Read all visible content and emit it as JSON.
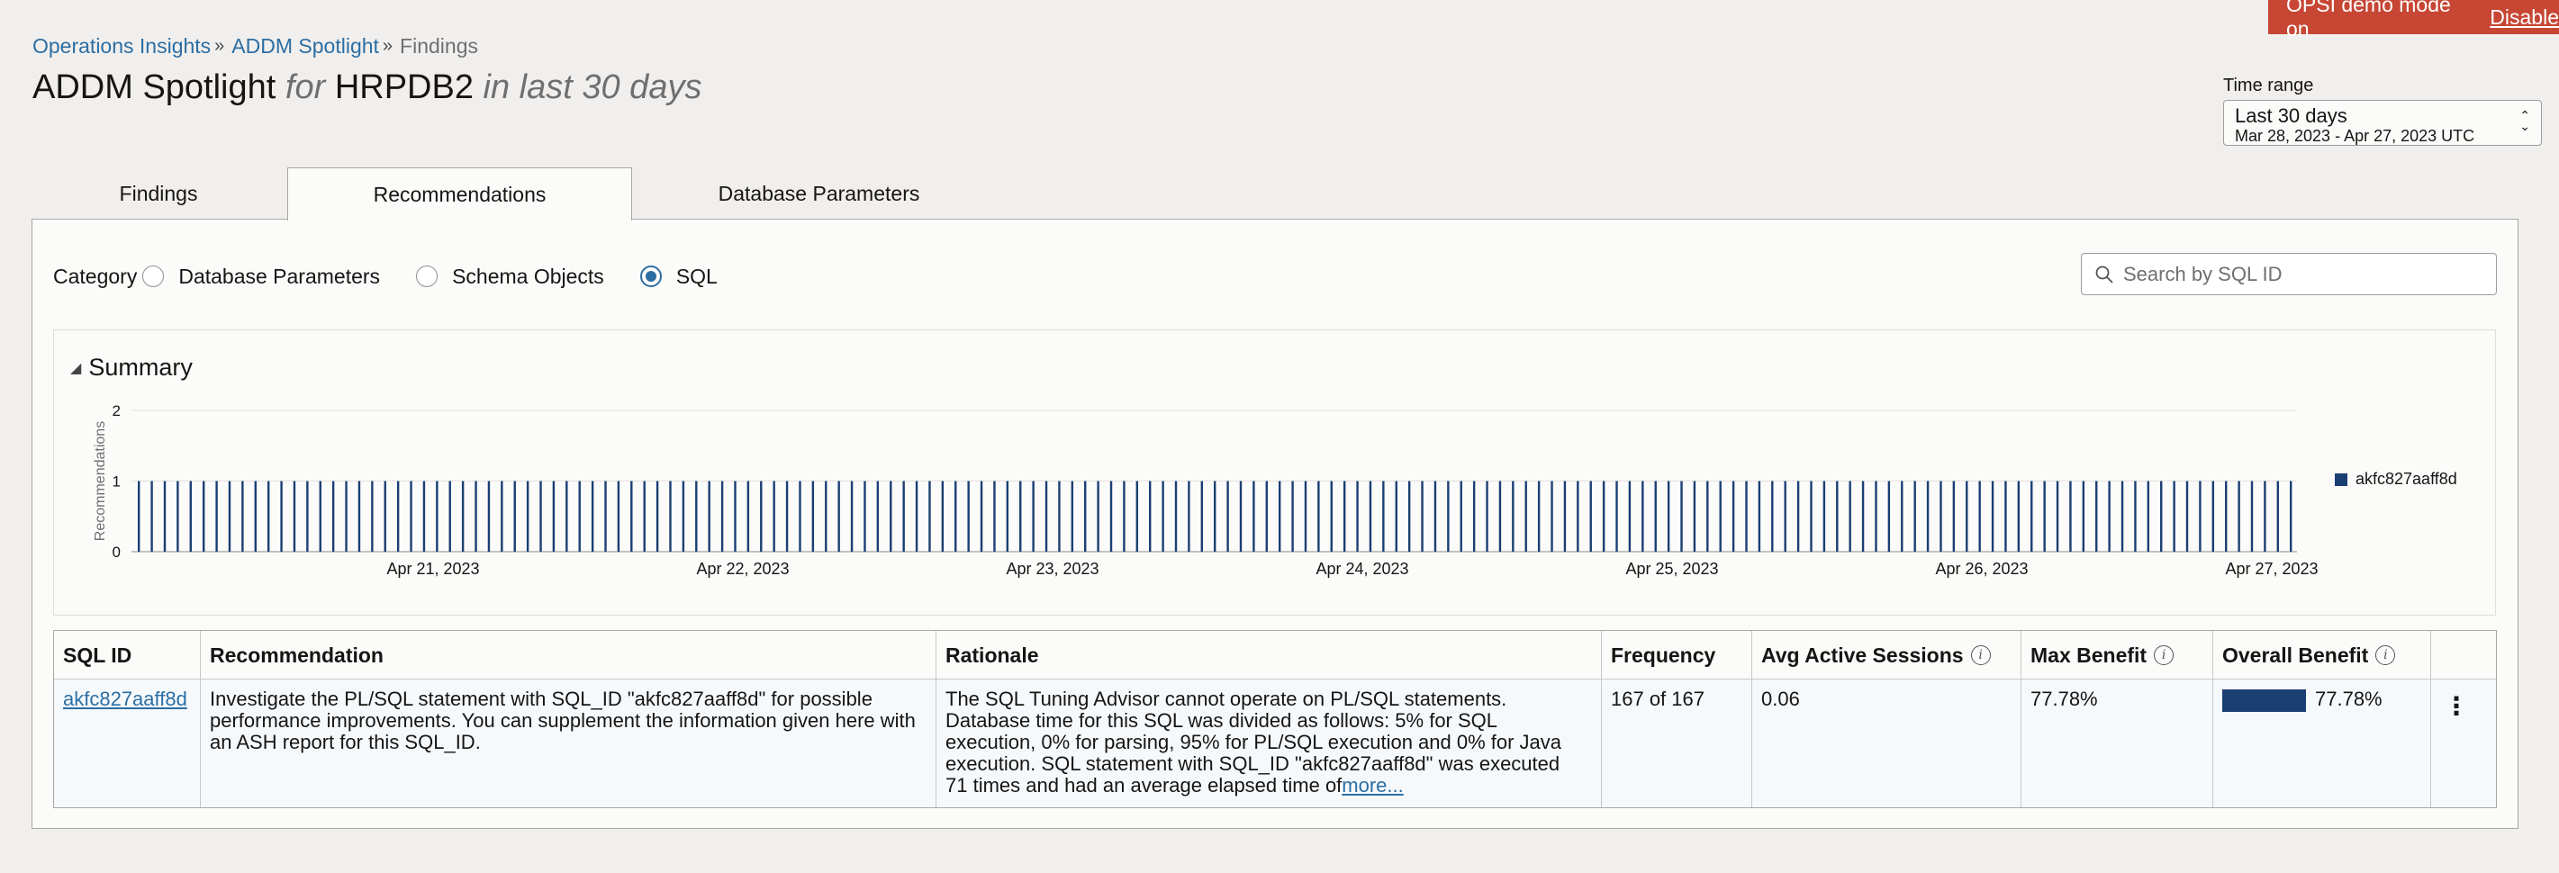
{
  "banner": {
    "text": "OPSI demo mode on",
    "action": "Disable"
  },
  "breadcrumb": [
    {
      "label": "Operations Insights"
    },
    {
      "label": "ADDM Spotlight"
    },
    {
      "label": "Findings"
    }
  ],
  "title": {
    "main": "ADDM Spotlight",
    "for": "for",
    "db": "HRPDB2",
    "period": "in last 30 days"
  },
  "time_range": {
    "label": "Time range",
    "value": "Last 30 days",
    "sub": "Mar 28, 2023 - Apr 27, 2023 UTC"
  },
  "tabs": [
    {
      "label": "Findings",
      "selected": false
    },
    {
      "label": "Recommendations",
      "selected": true
    },
    {
      "label": "Database Parameters",
      "selected": false
    }
  ],
  "category": {
    "label": "Category",
    "options": [
      {
        "label": "Database Parameters",
        "checked": false
      },
      {
        "label": "Schema Objects",
        "checked": false
      },
      {
        "label": "SQL",
        "checked": true
      }
    ]
  },
  "search": {
    "placeholder": "Search by SQL ID"
  },
  "summary": {
    "title": "Summary"
  },
  "colors": {
    "accent": "#2c6ea3",
    "bar": "#1a3f73",
    "banner": "#c74634"
  },
  "chart_data": {
    "type": "bar",
    "title": "",
    "ylabel": "Recommendations",
    "xlabel": "",
    "ylim": [
      0,
      2
    ],
    "yticks": [
      "0",
      "1",
      "2"
    ],
    "xtick_labels": [
      "Apr 21, 2023",
      "Apr 22, 2023",
      "Apr 23, 2023",
      "Apr 24, 2023",
      "Apr 25, 2023",
      "Apr 26, 2023",
      "Apr 27, 2023"
    ],
    "x_start": "Apr 20, 2023",
    "x_end": "Apr 27, 2023",
    "series": [
      {
        "name": "akfc827aaff8d",
        "color": "#1a3f73",
        "bar_value": 1,
        "bar_count": 167
      }
    ],
    "grid": true,
    "legend": "right"
  },
  "table": {
    "columns": [
      {
        "label": "SQL ID",
        "info": false
      },
      {
        "label": "Recommendation",
        "info": false
      },
      {
        "label": "Rationale",
        "info": false
      },
      {
        "label": "Frequency",
        "info": false
      },
      {
        "label": "Avg Active Sessions",
        "info": true
      },
      {
        "label": "Max Benefit",
        "info": true
      },
      {
        "label": "Overall Benefit",
        "info": true
      }
    ],
    "rows": [
      {
        "sql_id": "akfc827aaff8d",
        "recommendation": "Investigate the PL/SQL statement with SQL_ID \"akfc827aaff8d\" for possible performance improvements. You can supplement the information given here with an ASH report for this SQL_ID.",
        "rationale": "The SQL Tuning Advisor cannot operate on PL/SQL statements. Database time for this SQL was divided as follows: 5% for SQL execution, 0% for parsing, 95% for PL/SQL execution and 0% for Java execution. SQL statement with SQL_ID \"akfc827aaff8d\" was executed 71 times and had an average elapsed time of",
        "more": "more...",
        "frequency": "167 of 167",
        "avg_active_sessions": "0.06",
        "max_benefit": "77.78%",
        "overall_benefit": "77.78%",
        "overall_benefit_fraction": 0.7778
      }
    ]
  }
}
